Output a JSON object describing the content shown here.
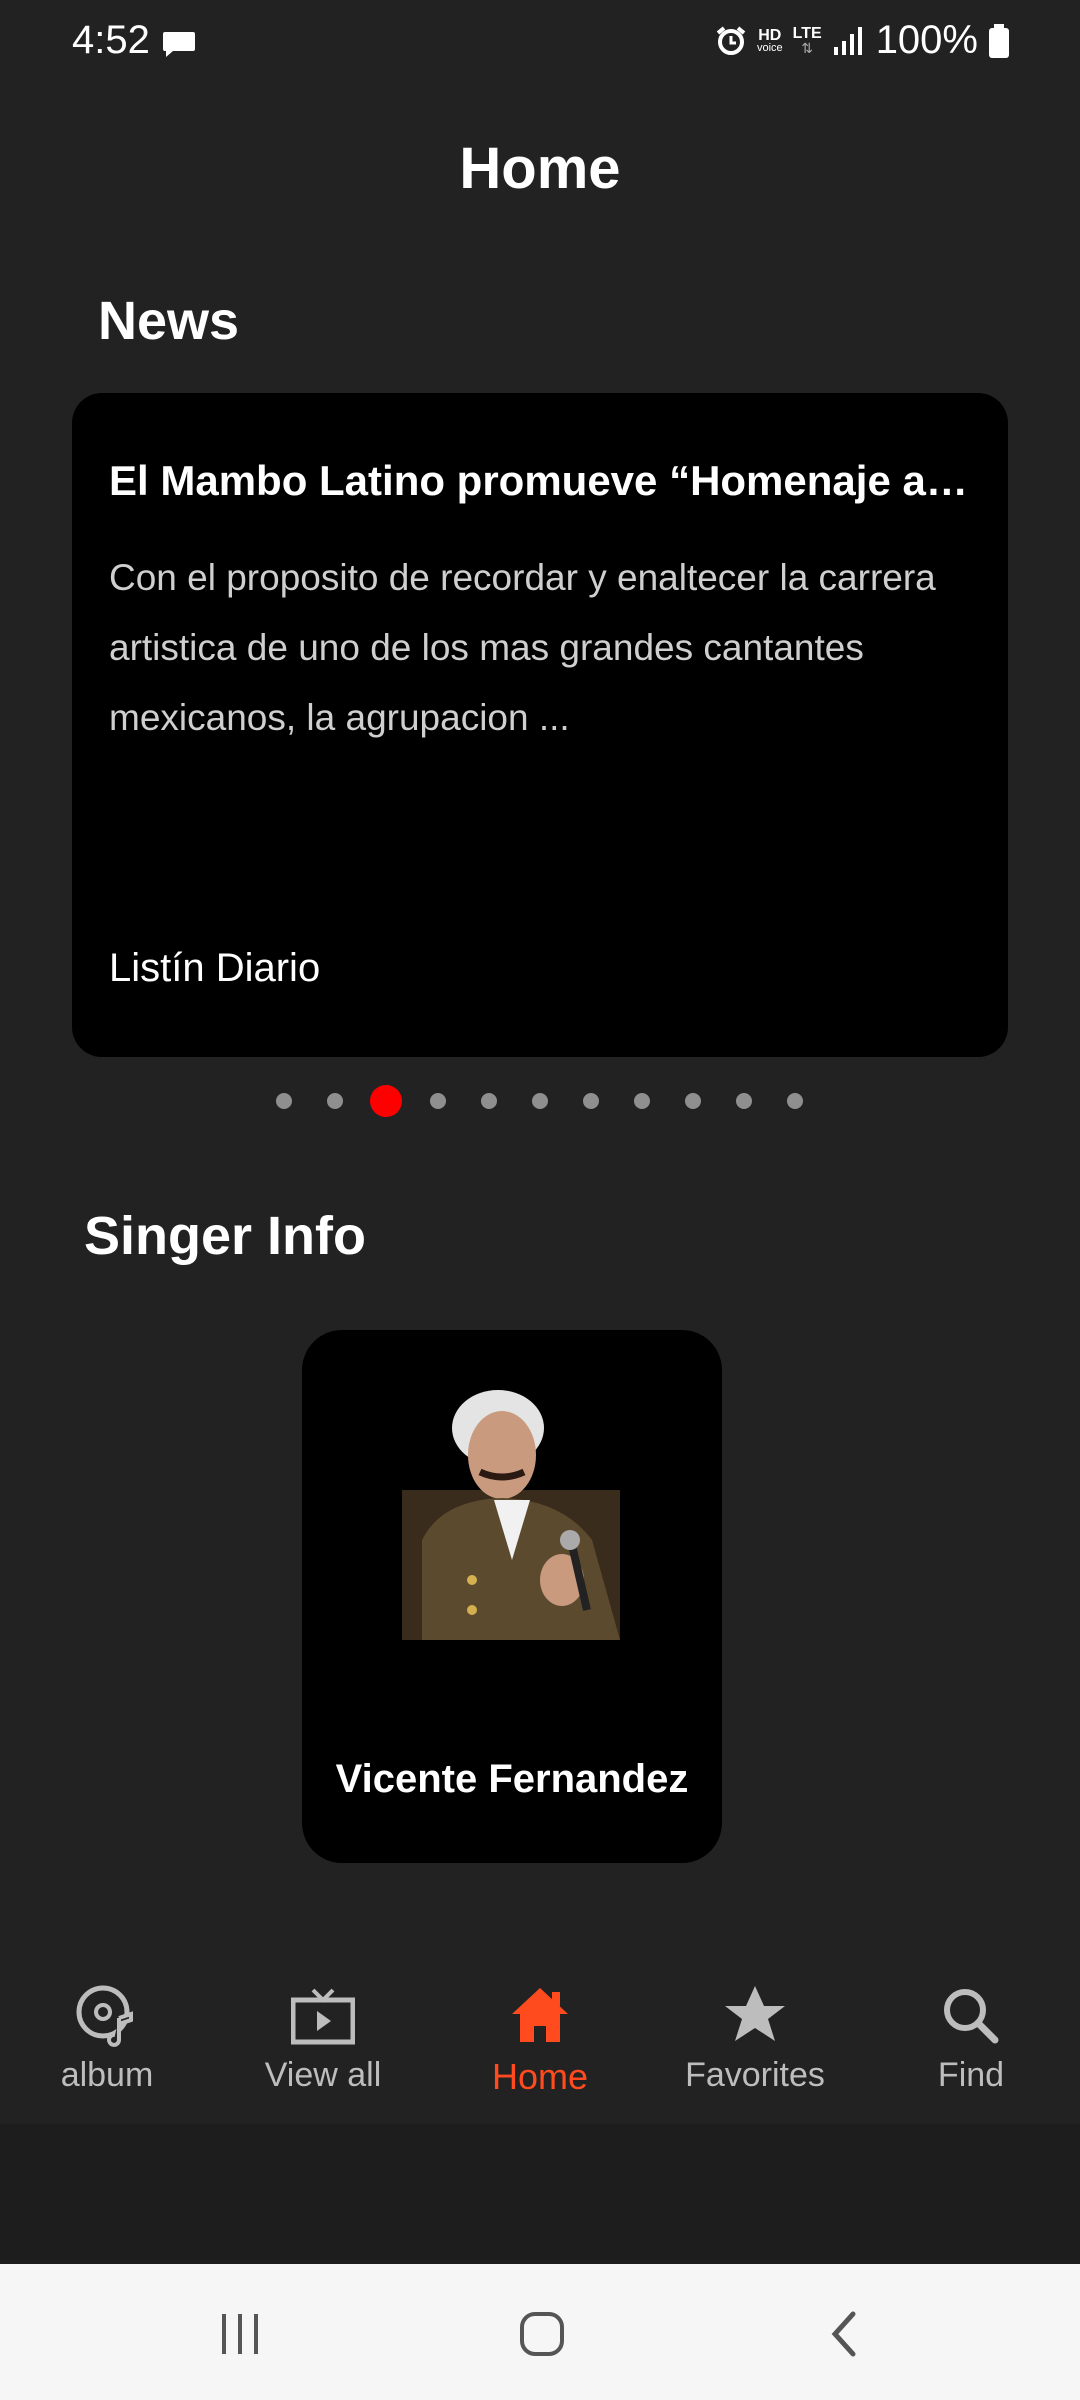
{
  "status_bar": {
    "time": "4:52",
    "battery": "100%",
    "icons": [
      "message-icon",
      "alarm-icon",
      "hd-voice-icon",
      "lte-icon",
      "signal-icon",
      "battery-icon"
    ],
    "hd_text": "HD",
    "voice_text": "voice",
    "lte_text": "LTE"
  },
  "header": {
    "title": "Home"
  },
  "news": {
    "section_title": "News",
    "card": {
      "headline": "El Mambo Latino promueve “Homenaje a…",
      "summary": "Con el proposito de recordar y enaltecer la carrera artistica de uno de los mas grandes cantantes mexicanos, la agrupacion ...",
      "source": "Listín Diario"
    },
    "pager": {
      "total": 11,
      "active_index": 2
    }
  },
  "singer_info": {
    "section_title": "Singer Info",
    "singer": {
      "name": "Vicente Fernandez"
    }
  },
  "bottom_nav": {
    "items": [
      {
        "label": "album",
        "icon": "album-music-icon",
        "active": false
      },
      {
        "label": "View all",
        "icon": "tv-play-icon",
        "active": false
      },
      {
        "label": "Home",
        "icon": "home-icon",
        "active": true
      },
      {
        "label": "Favorites",
        "icon": "star-icon",
        "active": false
      },
      {
        "label": "Find",
        "icon": "search-icon",
        "active": false
      }
    ],
    "active_color": "#ff4b1e",
    "inactive_color": "#bdbdbd"
  },
  "system_nav": {
    "buttons": [
      "recents-icon",
      "home-circle-icon",
      "back-icon"
    ]
  },
  "colors": {
    "background": "#222223",
    "card": "#000000",
    "pager_active": "#ff0000",
    "pager_inactive": "#8f8f8f"
  }
}
